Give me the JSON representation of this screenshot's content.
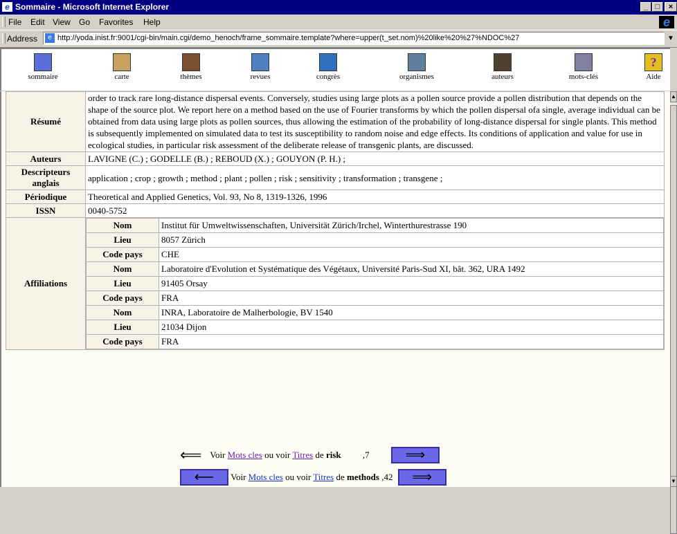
{
  "window": {
    "title": "Sommaire - Microsoft Internet Explorer",
    "min": "_",
    "max": "□",
    "close": "×"
  },
  "menu": [
    "File",
    "Edit",
    "View",
    "Go",
    "Favorites",
    "Help"
  ],
  "address": {
    "label": "Address",
    "url": "http://yoda.inist.fr:9001/cgi-bin/main.cgi/demo_henoch/frame_sommaire.template?where=upper(t_set.nom)%20like%20%27%NDOC%27"
  },
  "nav": [
    {
      "label": "sommaire",
      "icon": "summary-icon",
      "color": "#5a6fd8"
    },
    {
      "label": "carte",
      "icon": "map-icon",
      "color": "#c8a060"
    },
    {
      "label": "thèmes",
      "icon": "themes-icon",
      "color": "#7a5030"
    },
    {
      "label": "revues",
      "icon": "journals-icon",
      "color": "#5080c0"
    },
    {
      "label": "congrès",
      "icon": "congress-icon",
      "color": "#3070c0"
    },
    {
      "label": "organismes",
      "icon": "organizations-icon",
      "color": "#6080a0"
    },
    {
      "label": "auteurs",
      "icon": "authors-icon",
      "color": "#504030"
    },
    {
      "label": "mots-clés",
      "icon": "keywords-icon",
      "color": "#8080a0"
    },
    {
      "label": "Aide",
      "icon": "help-icon",
      "color": "#e0c020"
    }
  ],
  "record": {
    "resume_label": "Résumé",
    "resume": "order to track rare long-distance dispersal events. Conversely, studies using large plots as a pollen source provide a pollen distribution that depends on the shape of the source plot. We report here on a method based on the use of Fourier transforms by which the pollen dispersal ofa single, average individual can be obtained from data using large plots as pollen sources, thus allowing the estimation of the probability of long-distance dispersal for single plants. This method is subsequently implemented on simulated data to test its susceptibility to random noise and edge effects. Its conditions of application and value for use in ecological studies, in particular risk assessment of the deliberate release of transgenic plants, are discussed.",
    "auteurs_label": "Auteurs",
    "auteurs": "LAVIGNE (C.) ; GODELLE (B.) ; REBOUD (X.) ; GOUYON (P. H.) ;",
    "descripteurs_label": "Descripteurs anglais",
    "descripteurs": "application ; crop ; growth ; method ; plant ; pollen ; risk ; sensitivity ; transformation ; transgene ;",
    "periodique_label": "Périodique",
    "periodique": "Theoretical and Applied Genetics, Vol. 93, No 8, 1319-1326, 1996",
    "issn_label": "ISSN",
    "issn": "0040-5752",
    "affiliations_label": "Affiliations",
    "aff_keys": {
      "nom": "Nom",
      "lieu": "Lieu",
      "code": "Code pays"
    },
    "affiliations": [
      {
        "nom": "Institut für Umweltwissenschaften, Universität Zürich/Irchel, Winterthurestrasse 190",
        "lieu": "8057 Zürich",
        "code": "CHE"
      },
      {
        "nom": "Laboratoire d'Evolution et Systématique des Végétaux, Université Paris-Sud XI, bât. 362, URA 1492",
        "lieu": "91405 Orsay",
        "code": "FRA"
      },
      {
        "nom": "INRA, Laboratoire de Malherbologie, BV 1540",
        "lieu": "21034 Dijon",
        "code": "FRA"
      }
    ]
  },
  "bottom": {
    "voir": "Voir",
    "mots_cles": "Mots cles",
    "ou_voir": "ou voir",
    "titres": "Titres",
    "de": "de",
    "row1_term": "risk",
    "row1_count": ",7",
    "row2_term": "methods",
    "row2_count": ",42",
    "left_arrow": "⟸",
    "btn_left": "⟵",
    "btn_right": "⟹"
  }
}
